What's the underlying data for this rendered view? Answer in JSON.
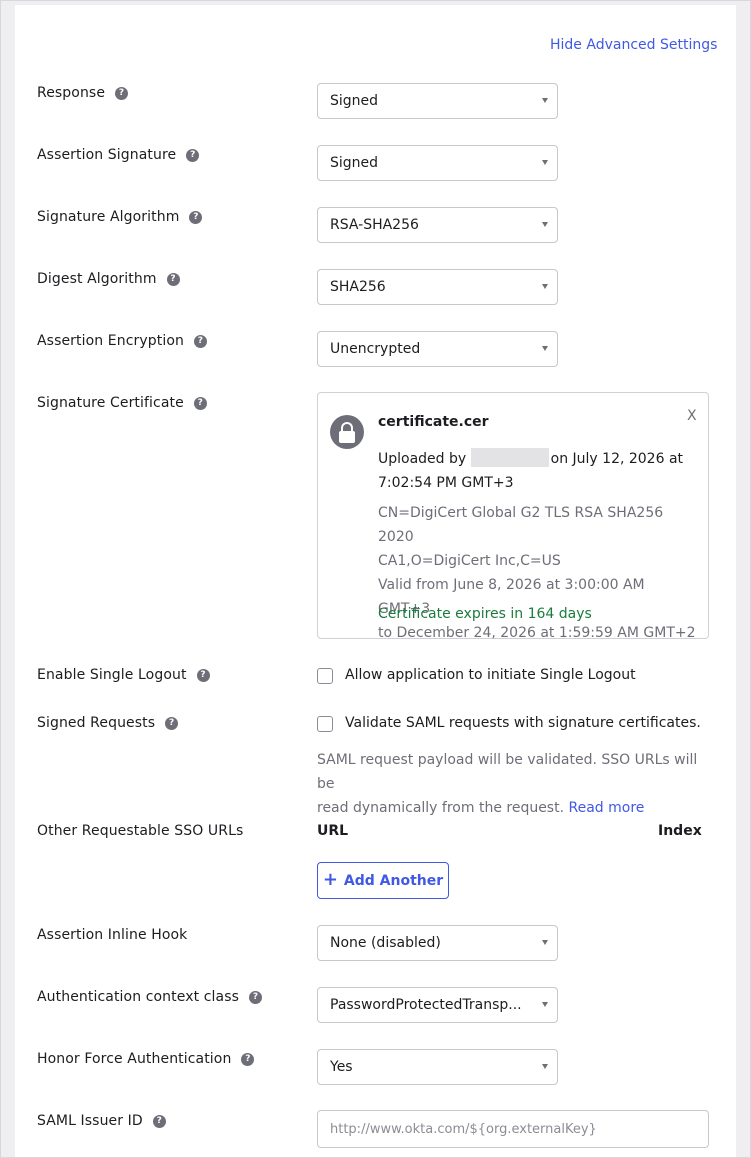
{
  "header": {
    "hide_advanced": "Hide Advanced Settings"
  },
  "fields": {
    "response": {
      "label": "Response",
      "value": "Signed"
    },
    "assertion_signature": {
      "label": "Assertion Signature",
      "value": "Signed"
    },
    "signature_algorithm": {
      "label": "Signature Algorithm",
      "value": "RSA-SHA256"
    },
    "digest_algorithm": {
      "label": "Digest Algorithm",
      "value": "SHA256"
    },
    "assertion_encryption": {
      "label": "Assertion Encryption",
      "value": "Unencrypted"
    },
    "signature_certificate": {
      "label": "Signature Certificate"
    },
    "enable_single_logout": {
      "label": "Enable Single Logout",
      "option": "Allow application to initiate Single Logout",
      "checked": false
    },
    "signed_requests": {
      "label": "Signed Requests",
      "option": "Validate SAML requests with signature certificates.",
      "checked": false,
      "help_line1": "SAML request payload will be validated. SSO URLs will be",
      "help_line2": "read dynamically from the request.",
      "read_more": "Read more"
    },
    "other_sso_urls": {
      "label": "Other Requestable SSO URLs",
      "col_url": "URL",
      "col_index": "Index",
      "add_button": "Add Another"
    },
    "assertion_inline_hook": {
      "label": "Assertion Inline Hook",
      "value": "None (disabled)"
    },
    "auth_context_class": {
      "label": "Authentication context class",
      "value": "PasswordProtectedTransp..."
    },
    "honor_force_auth": {
      "label": "Honor Force Authentication",
      "value": "Yes"
    },
    "saml_issuer_id": {
      "label": "SAML Issuer ID",
      "placeholder": "http://www.okta.com/${org.externalKey}"
    }
  },
  "certificate": {
    "file_name": "certificate.cer",
    "close": "X",
    "uploaded_by_prefix": "Uploaded by",
    "uploaded_on": "on July 12, 2026 at",
    "uploaded_time": "7:02:54 PM GMT+3",
    "subject_line1": "CN=DigiCert Global G2 TLS RSA SHA256 2020",
    "subject_line2": "CA1,O=DigiCert Inc,C=US",
    "valid_from": "Valid from June 8, 2026 at 3:00:00 AM GMT+3",
    "valid_to": "to December 24, 2026 at 1:59:59 AM GMT+2",
    "expiry": "Certificate expires in 164 days"
  },
  "icons": {
    "help": "question-circle-icon",
    "lock": "lock-icon",
    "caret": "caret-down-icon",
    "plus": "plus-icon"
  },
  "colors": {
    "link": "#3f59e4",
    "success": "#1a7c3c",
    "muted": "#6e6e78"
  }
}
